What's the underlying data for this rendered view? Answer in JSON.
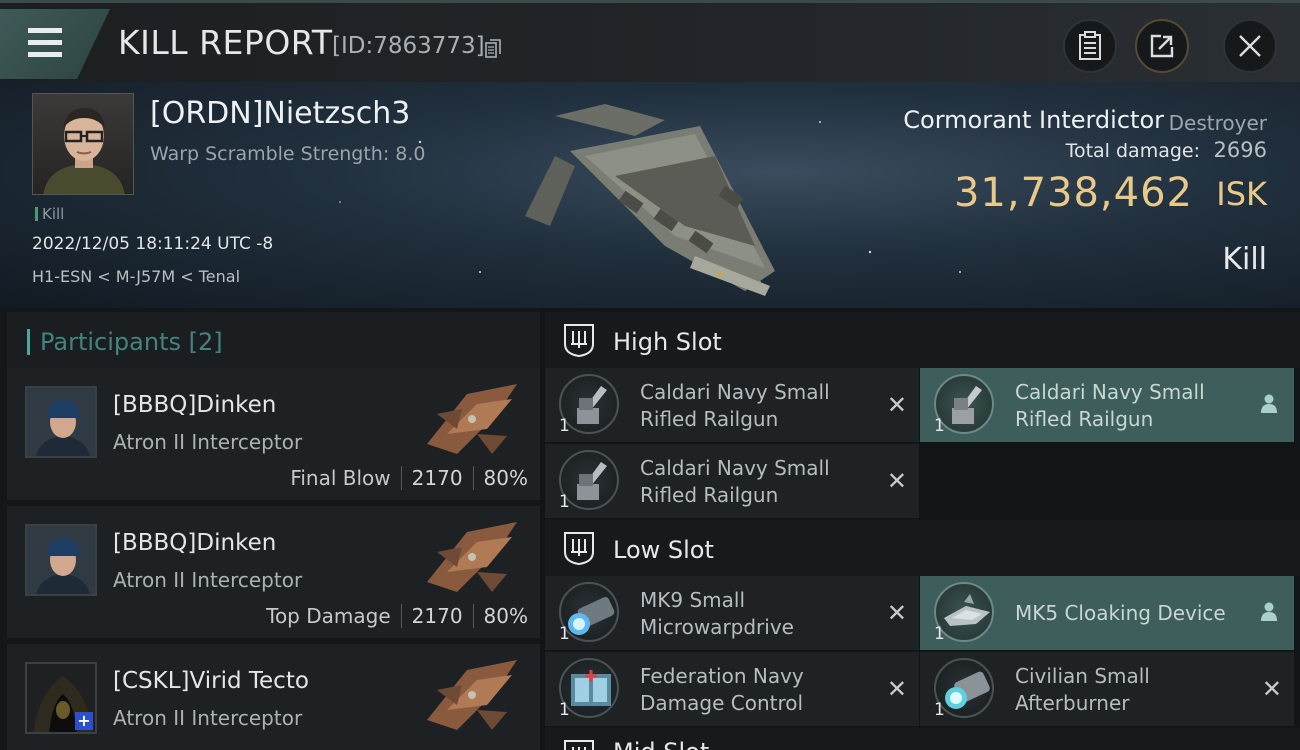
{
  "header": {
    "title": "KILL REPORT",
    "report_id": "[ID:7863773]"
  },
  "victim": {
    "pilot": "[ORDN]Nietzsch3",
    "warp_scramble": "Warp Scramble Strength: 8.0",
    "tag": "Kill",
    "datetime": "2022/12/05 18:11:24 UTC -8",
    "location": "H1-ESN < M-J57M < Tenal",
    "ship_name": "Cormorant Interdictor",
    "ship_class": "Destroyer",
    "total_damage_label": "Total damage:",
    "total_damage": "2696",
    "isk_value": "31,738,462",
    "isk_unit": "ISK",
    "kill_type": "Kill"
  },
  "participants": {
    "title": "Participants",
    "count": "[2]",
    "items": [
      {
        "name": "[BBBQ]Dinken",
        "ship": "Atron II Interceptor",
        "role": "Final Blow",
        "damage": "2170",
        "percent": "80%"
      },
      {
        "name": "[BBBQ]Dinken",
        "ship": "Atron II Interceptor",
        "role": "Top Damage",
        "damage": "2170",
        "percent": "80%"
      },
      {
        "name": "[CSKL]Virid Tecto",
        "ship": "Atron II Interceptor"
      }
    ]
  },
  "slots": {
    "high": {
      "label": "High Slot",
      "modules": [
        {
          "name": "Caldari Navy Small Rifled Railgun",
          "qty": "1"
        },
        {
          "name": "Caldari Navy Small Rifled Railgun",
          "qty": "1"
        },
        {
          "name": "Caldari Navy Small Rifled Railgun",
          "qty": "1"
        }
      ]
    },
    "low": {
      "label": "Low Slot",
      "modules": [
        {
          "name": "MK9 Small Microwarpdrive",
          "qty": "1"
        },
        {
          "name": "MK5 Cloaking Device",
          "qty": "1"
        },
        {
          "name": "Federation Navy Damage Control",
          "qty": "1"
        },
        {
          "name": "Civilian Small Afterburner",
          "qty": "1"
        }
      ]
    },
    "mid": {
      "label": "Mid Slot"
    }
  },
  "colors": {
    "accent_teal": "#3d5e5b",
    "isk_gold": "#e9c989",
    "kill_green": "#4c9c72"
  },
  "icons": [
    "menu-icon",
    "copy-icon",
    "clipboard-icon",
    "share-icon",
    "close-icon",
    "slot-icon",
    "railgun-icon",
    "microwarpdrive-icon",
    "cloak-icon",
    "damage-control-icon",
    "afterburner-icon",
    "user-icon"
  ]
}
